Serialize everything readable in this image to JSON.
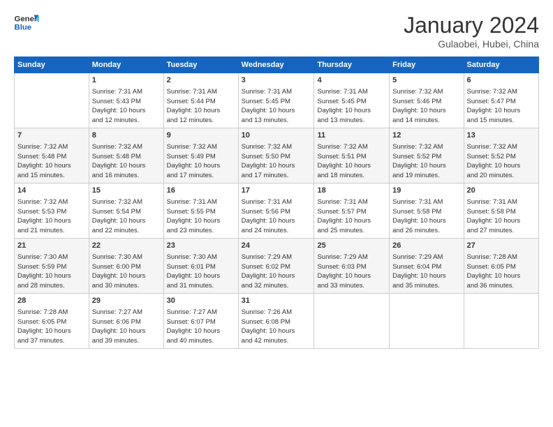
{
  "logo": {
    "line1": "General",
    "line2": "Blue"
  },
  "header": {
    "month": "January 2024",
    "location": "Gulaobei, Hubei, China"
  },
  "weekdays": [
    "Sunday",
    "Monday",
    "Tuesday",
    "Wednesday",
    "Thursday",
    "Friday",
    "Saturday"
  ],
  "weeks": [
    [
      {
        "day": "",
        "info": ""
      },
      {
        "day": "1",
        "info": "Sunrise: 7:31 AM\nSunset: 5:43 PM\nDaylight: 10 hours\nand 12 minutes."
      },
      {
        "day": "2",
        "info": "Sunrise: 7:31 AM\nSunset: 5:44 PM\nDaylight: 10 hours\nand 12 minutes."
      },
      {
        "day": "3",
        "info": "Sunrise: 7:31 AM\nSunset: 5:45 PM\nDaylight: 10 hours\nand 13 minutes."
      },
      {
        "day": "4",
        "info": "Sunrise: 7:31 AM\nSunset: 5:45 PM\nDaylight: 10 hours\nand 13 minutes."
      },
      {
        "day": "5",
        "info": "Sunrise: 7:32 AM\nSunset: 5:46 PM\nDaylight: 10 hours\nand 14 minutes."
      },
      {
        "day": "6",
        "info": "Sunrise: 7:32 AM\nSunset: 5:47 PM\nDaylight: 10 hours\nand 15 minutes."
      }
    ],
    [
      {
        "day": "7",
        "info": "Sunrise: 7:32 AM\nSunset: 5:48 PM\nDaylight: 10 hours\nand 15 minutes."
      },
      {
        "day": "8",
        "info": "Sunrise: 7:32 AM\nSunset: 5:48 PM\nDaylight: 10 hours\nand 16 minutes."
      },
      {
        "day": "9",
        "info": "Sunrise: 7:32 AM\nSunset: 5:49 PM\nDaylight: 10 hours\nand 17 minutes."
      },
      {
        "day": "10",
        "info": "Sunrise: 7:32 AM\nSunset: 5:50 PM\nDaylight: 10 hours\nand 17 minutes."
      },
      {
        "day": "11",
        "info": "Sunrise: 7:32 AM\nSunset: 5:51 PM\nDaylight: 10 hours\nand 18 minutes."
      },
      {
        "day": "12",
        "info": "Sunrise: 7:32 AM\nSunset: 5:52 PM\nDaylight: 10 hours\nand 19 minutes."
      },
      {
        "day": "13",
        "info": "Sunrise: 7:32 AM\nSunset: 5:52 PM\nDaylight: 10 hours\nand 20 minutes."
      }
    ],
    [
      {
        "day": "14",
        "info": "Sunrise: 7:32 AM\nSunset: 5:53 PM\nDaylight: 10 hours\nand 21 minutes."
      },
      {
        "day": "15",
        "info": "Sunrise: 7:32 AM\nSunset: 5:54 PM\nDaylight: 10 hours\nand 22 minutes."
      },
      {
        "day": "16",
        "info": "Sunrise: 7:31 AM\nSunset: 5:55 PM\nDaylight: 10 hours\nand 23 minutes."
      },
      {
        "day": "17",
        "info": "Sunrise: 7:31 AM\nSunset: 5:56 PM\nDaylight: 10 hours\nand 24 minutes."
      },
      {
        "day": "18",
        "info": "Sunrise: 7:31 AM\nSunset: 5:57 PM\nDaylight: 10 hours\nand 25 minutes."
      },
      {
        "day": "19",
        "info": "Sunrise: 7:31 AM\nSunset: 5:58 PM\nDaylight: 10 hours\nand 26 minutes."
      },
      {
        "day": "20",
        "info": "Sunrise: 7:31 AM\nSunset: 5:58 PM\nDaylight: 10 hours\nand 27 minutes."
      }
    ],
    [
      {
        "day": "21",
        "info": "Sunrise: 7:30 AM\nSunset: 5:59 PM\nDaylight: 10 hours\nand 28 minutes."
      },
      {
        "day": "22",
        "info": "Sunrise: 7:30 AM\nSunset: 6:00 PM\nDaylight: 10 hours\nand 30 minutes."
      },
      {
        "day": "23",
        "info": "Sunrise: 7:30 AM\nSunset: 6:01 PM\nDaylight: 10 hours\nand 31 minutes."
      },
      {
        "day": "24",
        "info": "Sunrise: 7:29 AM\nSunset: 6:02 PM\nDaylight: 10 hours\nand 32 minutes."
      },
      {
        "day": "25",
        "info": "Sunrise: 7:29 AM\nSunset: 6:03 PM\nDaylight: 10 hours\nand 33 minutes."
      },
      {
        "day": "26",
        "info": "Sunrise: 7:29 AM\nSunset: 6:04 PM\nDaylight: 10 hours\nand 35 minutes."
      },
      {
        "day": "27",
        "info": "Sunrise: 7:28 AM\nSunset: 6:05 PM\nDaylight: 10 hours\nand 36 minutes."
      }
    ],
    [
      {
        "day": "28",
        "info": "Sunrise: 7:28 AM\nSunset: 6:05 PM\nDaylight: 10 hours\nand 37 minutes."
      },
      {
        "day": "29",
        "info": "Sunrise: 7:27 AM\nSunset: 6:06 PM\nDaylight: 10 hours\nand 39 minutes."
      },
      {
        "day": "30",
        "info": "Sunrise: 7:27 AM\nSunset: 6:07 PM\nDaylight: 10 hours\nand 40 minutes."
      },
      {
        "day": "31",
        "info": "Sunrise: 7:26 AM\nSunset: 6:08 PM\nDaylight: 10 hours\nand 42 minutes."
      },
      {
        "day": "",
        "info": ""
      },
      {
        "day": "",
        "info": ""
      },
      {
        "day": "",
        "info": ""
      }
    ]
  ]
}
